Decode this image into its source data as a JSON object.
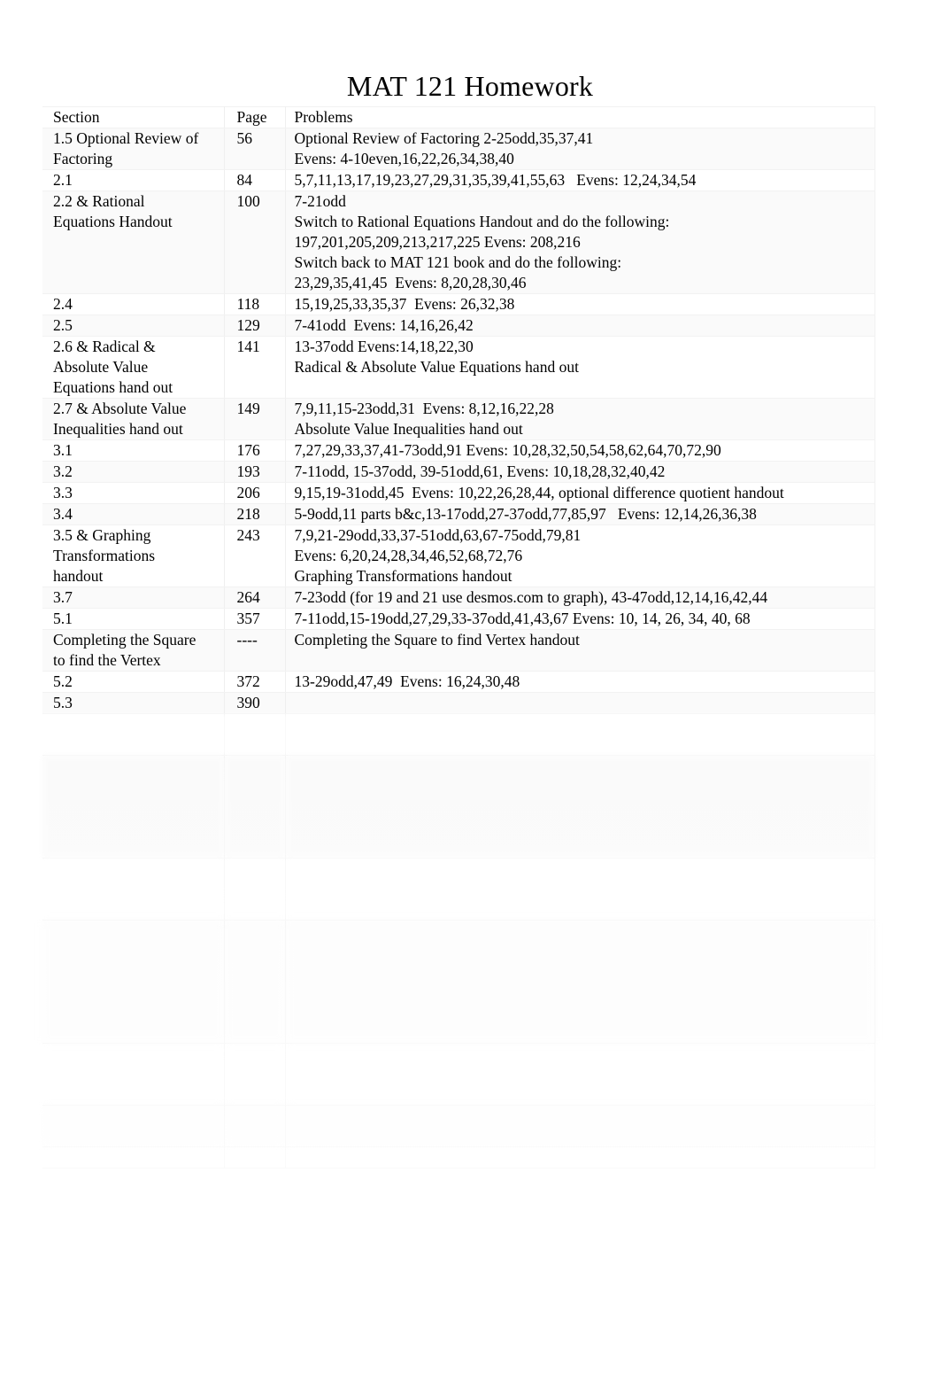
{
  "document": {
    "title": "MAT 121 Homework"
  },
  "table": {
    "headers": {
      "section": "Section",
      "page": "Page",
      "problems": "Problems"
    },
    "rows": [
      {
        "section": [
          "1.5 Optional Review of",
          "Factoring"
        ],
        "page": [
          "56"
        ],
        "problems": [
          "Optional Review of Factoring 2-25odd,35,37,41",
          "Evens: 4-10even,16,22,26,34,38,40"
        ]
      },
      {
        "section": [
          "2.1"
        ],
        "page": [
          "84"
        ],
        "problems": [
          "5,7,11,13,17,19,23,27,29,31,35,39,41,55,63   Evens: 12,24,34,54"
        ]
      },
      {
        "section": [
          "2.2 & Rational",
          "Equations Handout"
        ],
        "page": [
          "100"
        ],
        "problems": [
          "7-21odd",
          "Switch to Rational Equations Handout and do the following:",
          "197,201,205,209,213,217,225 Evens: 208,216",
          "Switch back to MAT 121 book and do the following:",
          "23,29,35,41,45  Evens: 8,20,28,30,46"
        ]
      },
      {
        "section": [
          "2.4"
        ],
        "page": [
          "118"
        ],
        "problems": [
          "15,19,25,33,35,37  Evens: 26,32,38"
        ]
      },
      {
        "section": [
          "2.5"
        ],
        "page": [
          "129"
        ],
        "problems": [
          "7-41odd  Evens: 14,16,26,42"
        ]
      },
      {
        "section": [
          "2.6 & Radical &",
          "Absolute Value",
          "Equations hand out"
        ],
        "page": [
          "141"
        ],
        "problems": [
          "13-37odd Evens:14,18,22,30",
          "Radical & Absolute Value Equations hand out"
        ]
      },
      {
        "section": [
          "2.7 & Absolute Value",
          "Inequalities hand out"
        ],
        "page": [
          "149"
        ],
        "problems": [
          "7,9,11,15-23odd,31  Evens: 8,12,16,22,28",
          "Absolute Value Inequalities hand out"
        ]
      },
      {
        "section": [
          "3.1"
        ],
        "page": [
          "176"
        ],
        "problems": [
          "7,27,29,33,37,41-73odd,91 Evens: 10,28,32,50,54,58,62,64,70,72,90"
        ]
      },
      {
        "section": [
          "3.2"
        ],
        "page": [
          "193"
        ],
        "problems": [
          "7-11odd, 15-37odd, 39-51odd,61, Evens: 10,18,28,32,40,42"
        ]
      },
      {
        "section": [
          "3.3"
        ],
        "page": [
          "206"
        ],
        "problems": [
          "9,15,19-31odd,45  Evens: 10,22,26,28,44, optional difference quotient handout"
        ]
      },
      {
        "section": [
          "3.4"
        ],
        "page": [
          "218"
        ],
        "problems": [
          "5-9odd,11 parts b&c,13-17odd,27-37odd,77,85,97   Evens: 12,14,26,36,38"
        ]
      },
      {
        "section": [
          "3.5 & Graphing",
          "Transformations",
          "handout"
        ],
        "page": [
          "243"
        ],
        "problems": [
          "7,9,21-29odd,33,37-51odd,63,67-75odd,79,81",
          "Evens: 6,20,24,28,34,46,52,68,72,76",
          "Graphing Transformations handout"
        ]
      },
      {
        "section": [
          "3.7"
        ],
        "page": [
          "264"
        ],
        "problems": [
          "7-23odd (for 19 and 21 use desmos.com to graph), 43-47odd,12,14,16,42,44"
        ]
      },
      {
        "section": [
          "5.1"
        ],
        "page": [
          "357"
        ],
        "problems": [
          "7-11odd,15-19odd,27,29,33-37odd,41,43,67 Evens: 10, 14, 26, 34, 40, 68"
        ]
      },
      {
        "section": [
          "Completing the Square",
          "to find the Vertex"
        ],
        "page": [
          "----"
        ],
        "problems": [
          "Completing the Square to find Vertex handout"
        ]
      },
      {
        "section": [
          "5.2"
        ],
        "page": [
          "372"
        ],
        "problems": [
          "13-29odd,47,49  Evens: 16,24,30,48"
        ]
      },
      {
        "section": [
          "5.3"
        ],
        "page": [
          "390"
        ],
        "problems": [
          ""
        ]
      }
    ]
  }
}
